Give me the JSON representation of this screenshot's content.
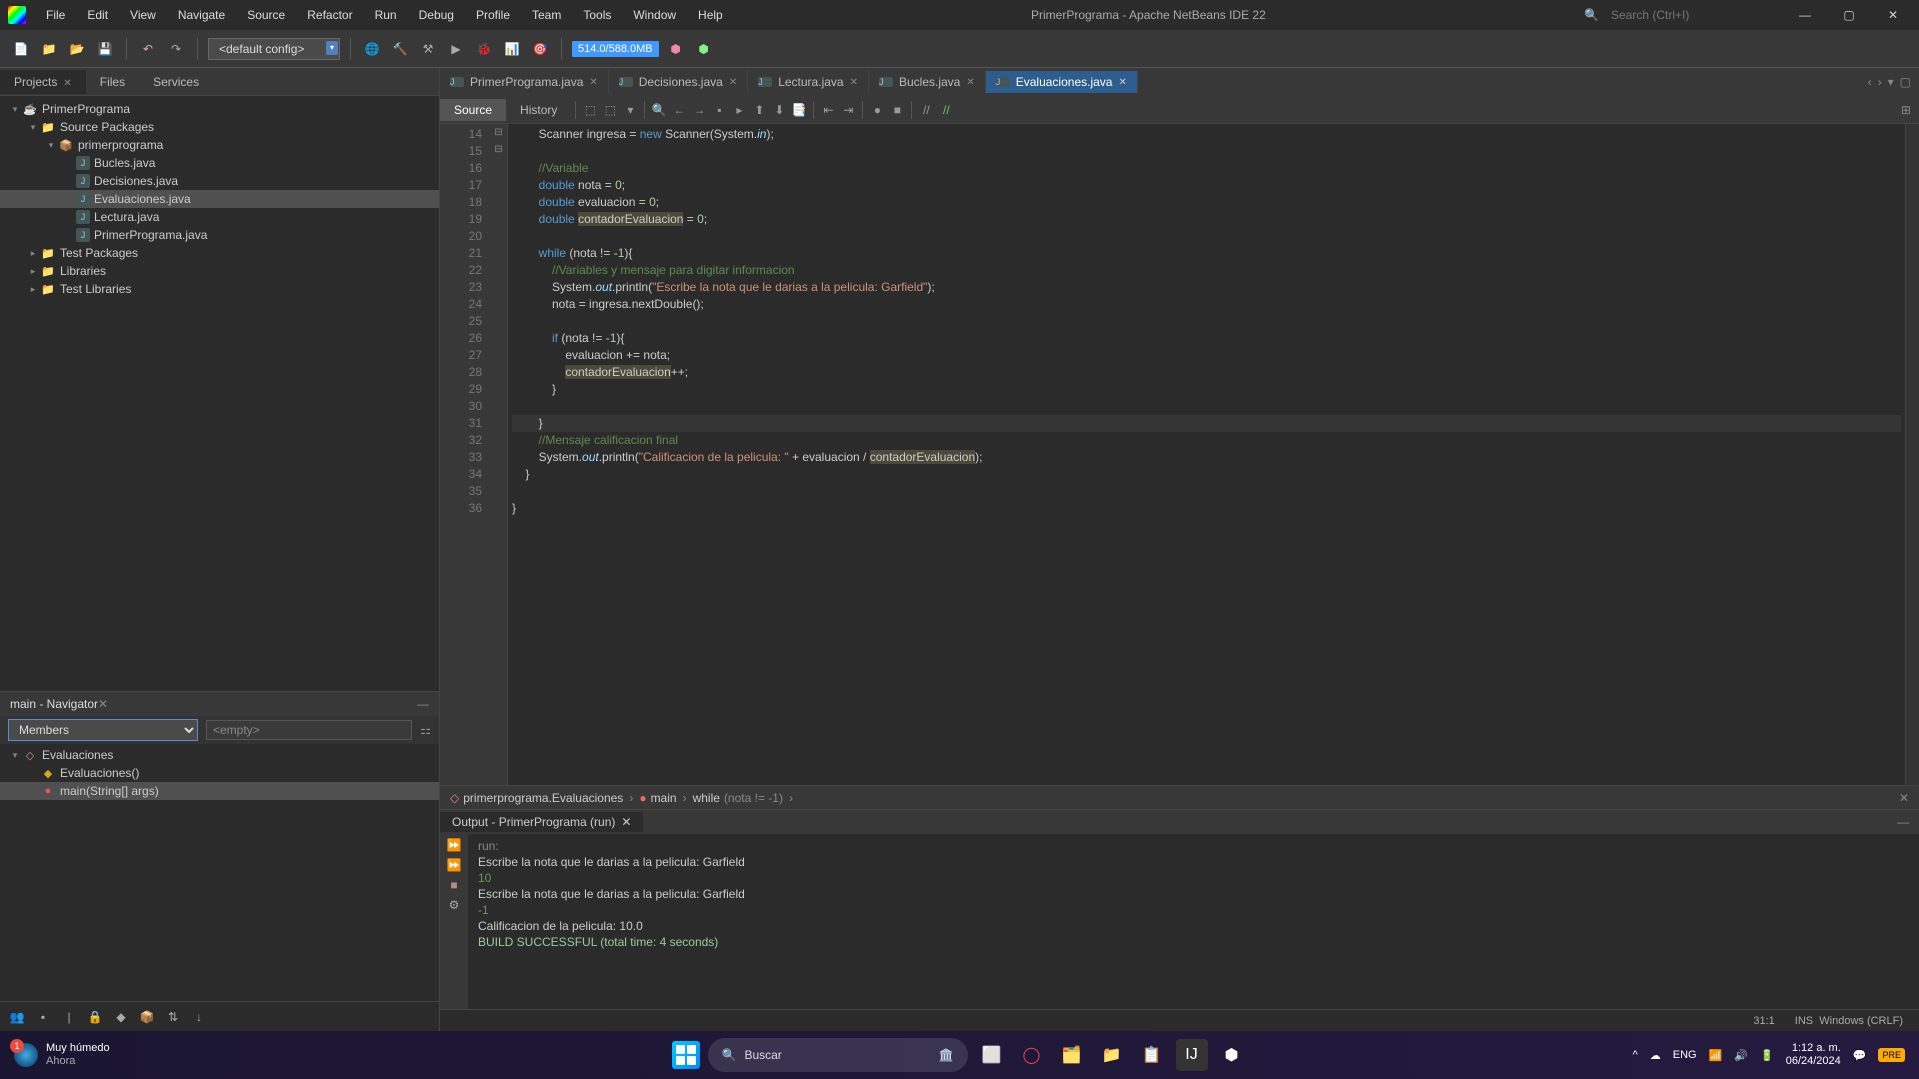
{
  "menubar": {
    "items": [
      "File",
      "Edit",
      "View",
      "Navigate",
      "Source",
      "Refactor",
      "Run",
      "Debug",
      "Profile",
      "Team",
      "Tools",
      "Window",
      "Help"
    ],
    "app_title": "PrimerPrograma - Apache NetBeans IDE 22",
    "search_placeholder": "Search (Ctrl+I)"
  },
  "toolbar": {
    "config_label": "<default config>",
    "memory": "514.0/588.0MB"
  },
  "projects_panel": {
    "tabs": [
      "Projects",
      "Files",
      "Services"
    ],
    "active_tab": "Projects",
    "tree": [
      {
        "level": 0,
        "expanded": true,
        "icon": "coffee",
        "label": "PrimerPrograma"
      },
      {
        "level": 1,
        "expanded": true,
        "icon": "folder",
        "label": "Source Packages"
      },
      {
        "level": 2,
        "expanded": true,
        "icon": "package",
        "label": "primerprograma"
      },
      {
        "level": 3,
        "icon": "java",
        "label": "Bucles.java"
      },
      {
        "level": 3,
        "icon": "java",
        "label": "Decisiones.java"
      },
      {
        "level": 3,
        "icon": "java",
        "label": "Evaluaciones.java",
        "selected": true
      },
      {
        "level": 3,
        "icon": "java",
        "label": "Lectura.java"
      },
      {
        "level": 3,
        "icon": "java",
        "label": "PrimerPrograma.java"
      },
      {
        "level": 1,
        "expanded": false,
        "icon": "folder",
        "label": "Test Packages"
      },
      {
        "level": 1,
        "expanded": false,
        "icon": "folder",
        "label": "Libraries"
      },
      {
        "level": 1,
        "expanded": false,
        "icon": "folder",
        "label": "Test Libraries"
      }
    ]
  },
  "navigator": {
    "title": "main - Navigator",
    "filter": "Members",
    "empty": "<empty>",
    "tree": [
      {
        "level": 0,
        "expanded": true,
        "icon": "class",
        "label": "Evaluaciones"
      },
      {
        "level": 1,
        "icon": "ctor",
        "label": "Evaluaciones()"
      },
      {
        "level": 1,
        "icon": "method",
        "label": "main(String[] args)",
        "selected": true
      }
    ]
  },
  "editor": {
    "tabs": [
      {
        "label": "PrimerPrograma.java"
      },
      {
        "label": "Decisiones.java"
      },
      {
        "label": "Lectura.java"
      },
      {
        "label": "Bucles.java"
      },
      {
        "label": "Evaluaciones.java",
        "active": true
      }
    ],
    "source_label": "Source",
    "history_label": "History",
    "first_line_no": 14,
    "breadcrumb": {
      "pkg": "primerprograma.Evaluaciones",
      "method": "main",
      "stmt": "while",
      "cond": "(nota != -1)"
    }
  },
  "output": {
    "title": "Output - PrimerPrograma (run)",
    "lines": [
      {
        "cls": "out-gray",
        "text": "run:"
      },
      {
        "cls": "",
        "text": "Escribe la nota que le darias a la pelicula: Garfield"
      },
      {
        "cls": "out-green",
        "text": "10"
      },
      {
        "cls": "",
        "text": "Escribe la nota que le darias a la pelicula: Garfield"
      },
      {
        "cls": "out-green",
        "text": "-1"
      },
      {
        "cls": "",
        "text": "Calificacion de la pelicula: 10.0"
      },
      {
        "cls": "out-build",
        "text": "BUILD SUCCESSFUL (total time: 4 seconds)"
      }
    ]
  },
  "statusbar": {
    "cursor": "31:1",
    "insert": "INS",
    "encoding": "Windows (CRLF)"
  },
  "taskbar": {
    "weather_title": "Muy húmedo",
    "weather_sub": "Ahora",
    "weather_badge": "1",
    "search_placeholder": "Buscar",
    "lang": "ENG",
    "time": "1:12 a. m.",
    "date": "06/24/2024"
  },
  "chart_data": null
}
